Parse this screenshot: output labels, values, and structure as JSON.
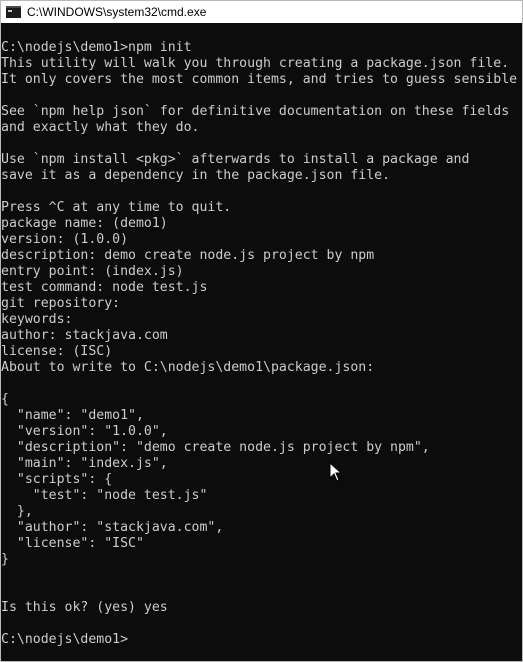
{
  "window": {
    "title": "C:\\WINDOWS\\system32\\cmd.exe",
    "icon": "cmd-icon"
  },
  "console": {
    "lines": [
      "C:\\nodejs\\demo1>npm init",
      "This utility will walk you through creating a package.json file.",
      "It only covers the most common items, and tries to guess sensible",
      "",
      "See `npm help json` for definitive documentation on these fields",
      "and exactly what they do.",
      "",
      "Use `npm install <pkg>` afterwards to install a package and",
      "save it as a dependency in the package.json file.",
      "",
      "Press ^C at any time to quit.",
      "package name: (demo1)",
      "version: (1.0.0)",
      "description: demo create node.js project by npm",
      "entry point: (index.js)",
      "test command: node test.js",
      "git repository:",
      "keywords:",
      "author: stackjava.com",
      "license: (ISC)",
      "About to write to C:\\nodejs\\demo1\\package.json:",
      "",
      "{",
      "  \"name\": \"demo1\",",
      "  \"version\": \"1.0.0\",",
      "  \"description\": \"demo create node.js project by npm\",",
      "  \"main\": \"index.js\",",
      "  \"scripts\": {",
      "    \"test\": \"node test.js\"",
      "  },",
      "  \"author\": \"stackjava.com\",",
      "  \"license\": \"ISC\"",
      "}",
      "",
      "",
      "Is this ok? (yes) yes",
      "",
      "C:\\nodejs\\demo1>"
    ]
  },
  "colors": {
    "background": "#0c0c0c",
    "text": "#cccccc",
    "titlebar": "#ffffff"
  }
}
